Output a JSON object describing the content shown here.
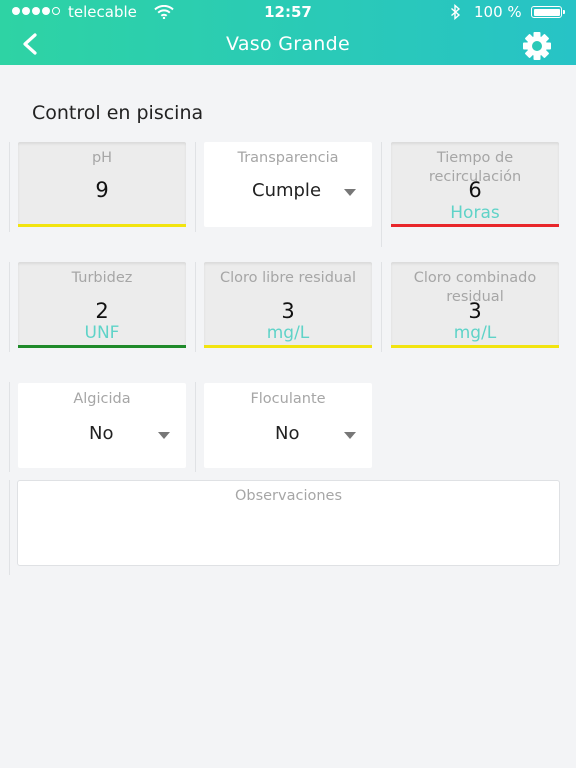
{
  "status_bar": {
    "carrier": "telecable",
    "time": "12:57",
    "battery_percent": "100 %",
    "signal_bars_filled": 4,
    "signal_bars_total": 5
  },
  "header": {
    "title": "Vaso Grande",
    "back_icon": "chevron-left-icon",
    "settings_icon": "gear-icon",
    "gradient_start": "#2ed3a4",
    "gradient_end": "#27c3c6"
  },
  "section": {
    "title": "Control en piscina"
  },
  "cards": {
    "ph": {
      "label": "pH",
      "value": "9",
      "status_color": "#f2e40f"
    },
    "transparencia": {
      "label": "Transparencia",
      "value": "Cumple"
    },
    "tiempo": {
      "label": "Tiempo de recirculación",
      "value": "6",
      "unit": "Horas",
      "status_color": "#e8262a"
    },
    "turbidez": {
      "label": "Turbidez",
      "value": "2",
      "unit": "UNF",
      "status_color": "#1f8a2a"
    },
    "cloro_libre": {
      "label": "Cloro libre residual",
      "value": "3",
      "unit": "mg/L",
      "status_color": "#f2e40f"
    },
    "cloro_combinado": {
      "label": "Cloro combinado residual",
      "value": "3",
      "unit": "mg/L",
      "status_color": "#f2e40f"
    },
    "algicida": {
      "label": "Algicida",
      "value": "No"
    },
    "floculante": {
      "label": "Floculante",
      "value": "No"
    }
  },
  "observaciones": {
    "label": "Observaciones",
    "value": ""
  }
}
